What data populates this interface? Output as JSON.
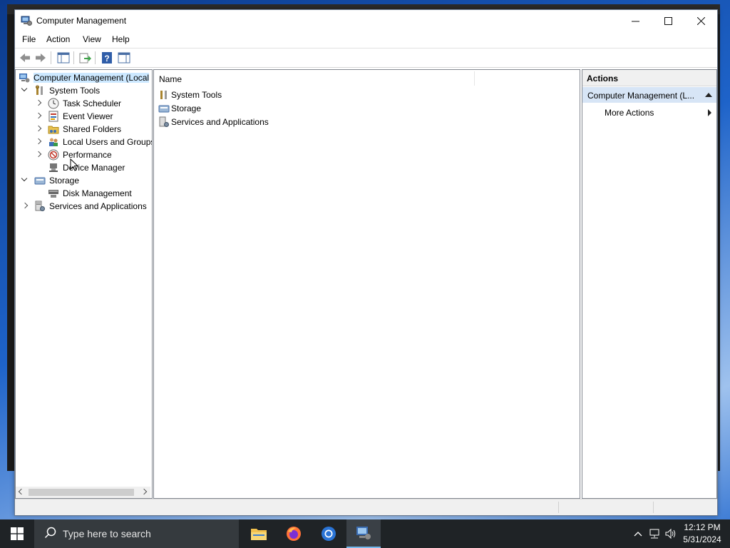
{
  "window": {
    "title": "Computer Management"
  },
  "menu": [
    "File",
    "Action",
    "View",
    "Help"
  ],
  "tree": {
    "root": "Computer Management (Local",
    "system_tools": "System Tools",
    "task_scheduler": "Task Scheduler",
    "event_viewer": "Event Viewer",
    "shared_folders": "Shared Folders",
    "local_users": "Local Users and Groups",
    "performance": "Performance",
    "device_manager": "Device Manager",
    "storage": "Storage",
    "disk_management": "Disk Management",
    "services": "Services and Applications"
  },
  "center": {
    "column_name": "Name",
    "items": [
      "System Tools",
      "Storage",
      "Services and Applications"
    ]
  },
  "actions": {
    "header": "Actions",
    "section": "Computer Management (L...",
    "more_actions": "More Actions"
  },
  "taskbar": {
    "search_placeholder": "Type here to search",
    "time": "12:12 PM",
    "date": "5/31/2024"
  }
}
